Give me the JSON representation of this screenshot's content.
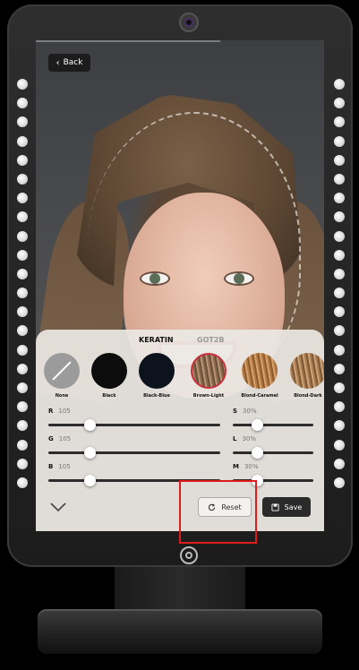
{
  "screen": {
    "back_label": "Back",
    "tabs": [
      {
        "label": "KERATIN",
        "active": true
      },
      {
        "label": "GOT2B",
        "active": false
      }
    ],
    "swatches": [
      {
        "label": "None",
        "color": "#9b9b9b"
      },
      {
        "label": "Black",
        "color": "#0c0c0c"
      },
      {
        "label": "Black-Blue",
        "color": "#0d131c"
      },
      {
        "label": "Brown-Light",
        "color": "#8a6a4e",
        "selected": true
      },
      {
        "label": "Blond-Caramel",
        "color": "#b07a45"
      },
      {
        "label": "Blond-Dark",
        "color": "#a37a52"
      }
    ],
    "sliders": [
      {
        "key": "R",
        "value": "105",
        "fraction": 0.244
      },
      {
        "key": "G",
        "value": "105",
        "fraction": 0.244
      },
      {
        "key": "B",
        "value": "105",
        "fraction": 0.244
      },
      {
        "key": "S",
        "value": "30%",
        "fraction": 0.3
      },
      {
        "key": "L",
        "value": "30%",
        "fraction": 0.3
      },
      {
        "key": "M",
        "value": "30%",
        "fraction": 0.3
      }
    ],
    "reset_label": "Reset",
    "save_label": "Save"
  },
  "colors": {
    "selected_ring": "#c9303e",
    "highlight": "#e01b1b",
    "track": "#2c2c2c"
  }
}
